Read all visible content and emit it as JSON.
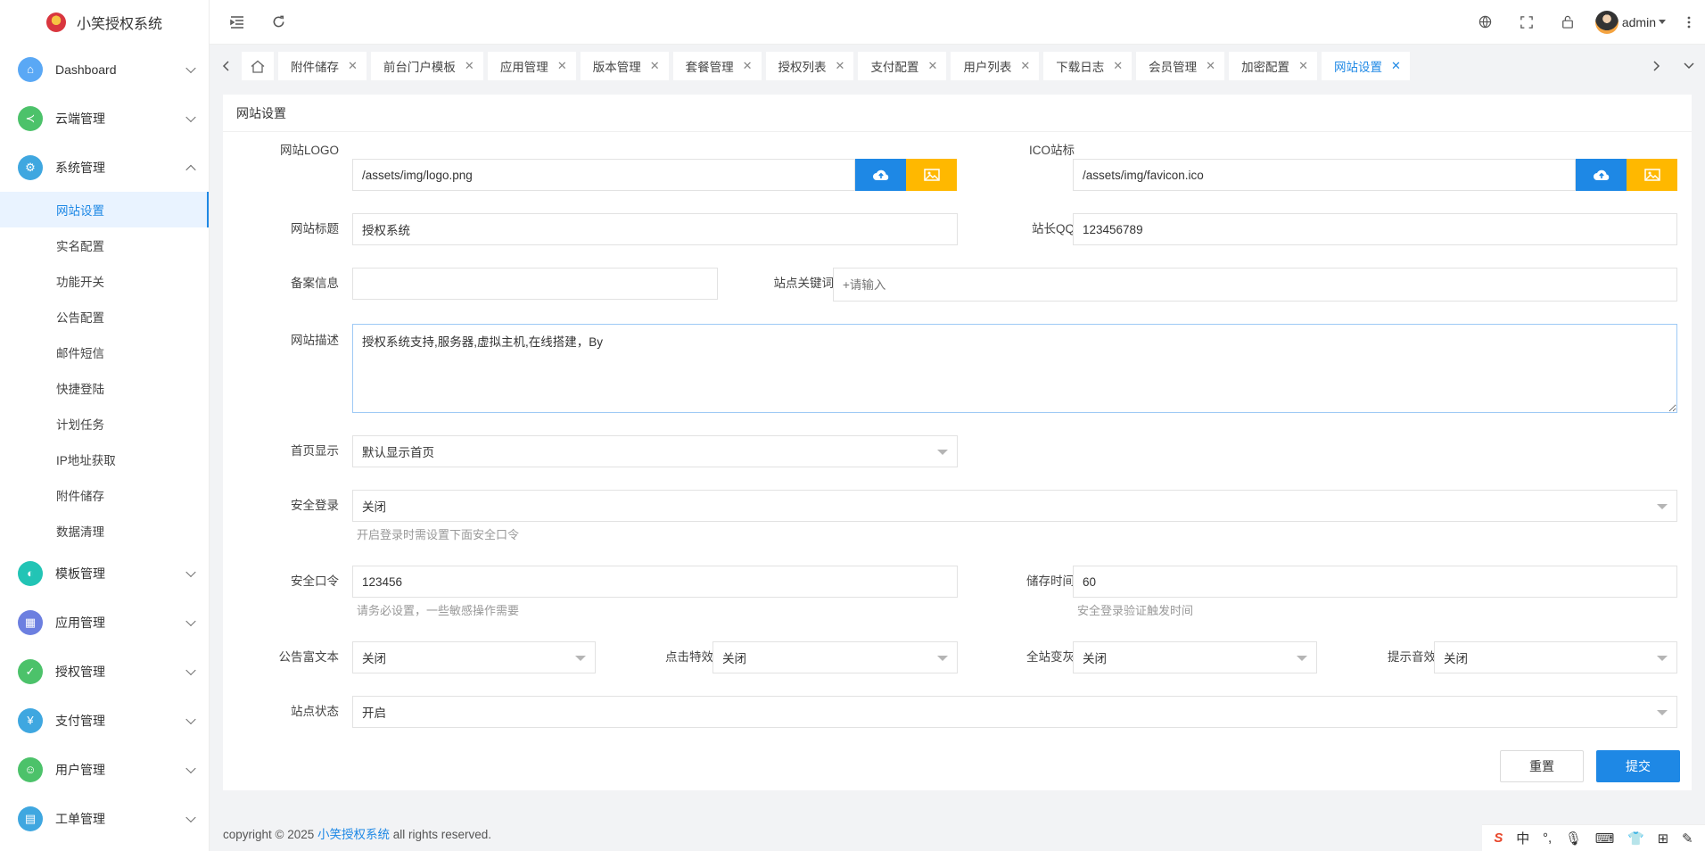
{
  "app": {
    "title": "小笑授权系统"
  },
  "sidebar": {
    "groups": [
      {
        "label": "Dashboard",
        "icon": "home-icon",
        "color": "#5aa8f5",
        "expanded": false
      },
      {
        "label": "云端管理",
        "icon": "share-icon",
        "color": "#4cc26a",
        "expanded": false
      },
      {
        "label": "系统管理",
        "icon": "gear-icon",
        "color": "#3fa7e0",
        "expanded": true
      },
      {
        "label": "模板管理",
        "icon": "palette-icon",
        "color": "#22c4b5",
        "expanded": false
      },
      {
        "label": "应用管理",
        "icon": "apps-icon",
        "color": "#6c7fe0",
        "expanded": false
      },
      {
        "label": "授权管理",
        "icon": "shield-icon",
        "color": "#4cc26a",
        "expanded": false
      },
      {
        "label": "支付管理",
        "icon": "yen-icon",
        "color": "#3fa7e0",
        "expanded": false
      },
      {
        "label": "用户管理",
        "icon": "user-icon",
        "color": "#4cc26a",
        "expanded": false
      },
      {
        "label": "工单管理",
        "icon": "ticket-icon",
        "color": "#3fa7e0",
        "expanded": false
      }
    ],
    "sub_items": [
      "网站设置",
      "实名配置",
      "功能开关",
      "公告配置",
      "邮件短信",
      "快捷登陆",
      "计划任务",
      "IP地址获取",
      "附件储存",
      "数据清理"
    ]
  },
  "header": {
    "username": "admin"
  },
  "tabs": {
    "items": [
      "附件储存",
      "前台门户模板",
      "应用管理",
      "版本管理",
      "套餐管理",
      "授权列表",
      "支付配置",
      "用户列表",
      "下载日志",
      "会员管理",
      "加密配置",
      "网站设置"
    ],
    "active": "网站设置"
  },
  "form": {
    "card_title": "网站设置",
    "logo_label": "网站LOGO",
    "logo_value": "/assets/img/logo.png",
    "ico_label": "ICO站标",
    "ico_value": "/assets/img/favicon.ico",
    "site_title_label": "网站标题",
    "site_title_value": "授权系统",
    "qq_label": "站长QQ",
    "qq_value": "123456789",
    "icp_label": "备案信息",
    "icp_value": "",
    "keywords_label": "站点关键词",
    "keywords_placeholder": "+请输入",
    "desc_label": "网站描述",
    "desc_value": "授权系统支持,服务器,虚拟主机,在线搭建，By",
    "home_label": "首页显示",
    "home_value": "默认显示首页",
    "safe_login_label": "安全登录",
    "safe_login_value": "关闭",
    "safe_login_hint": "开启登录时需设置下面安全口令",
    "safe_code_label": "安全口令",
    "safe_code_value": "123456",
    "safe_code_hint": "请务必设置，一些敏感操作需要",
    "store_time_label": "储存时间",
    "store_time_value": "60",
    "store_time_hint": "安全登录验证触发时间",
    "rich_label": "公告富文本",
    "rich_value": "关闭",
    "click_label": "点击特效",
    "click_value": "关闭",
    "gray_label": "全站变灰",
    "gray_value": "关闭",
    "sound_label": "提示音效",
    "sound_value": "关闭",
    "status_label": "站点状态",
    "status_value": "开启",
    "reset_label": "重置",
    "submit_label": "提交"
  },
  "footer": {
    "prefix": "copyright © 2025 ",
    "link": "小笑授权系统",
    "suffix": " all rights reserved."
  },
  "ime": {
    "lang": "中"
  }
}
